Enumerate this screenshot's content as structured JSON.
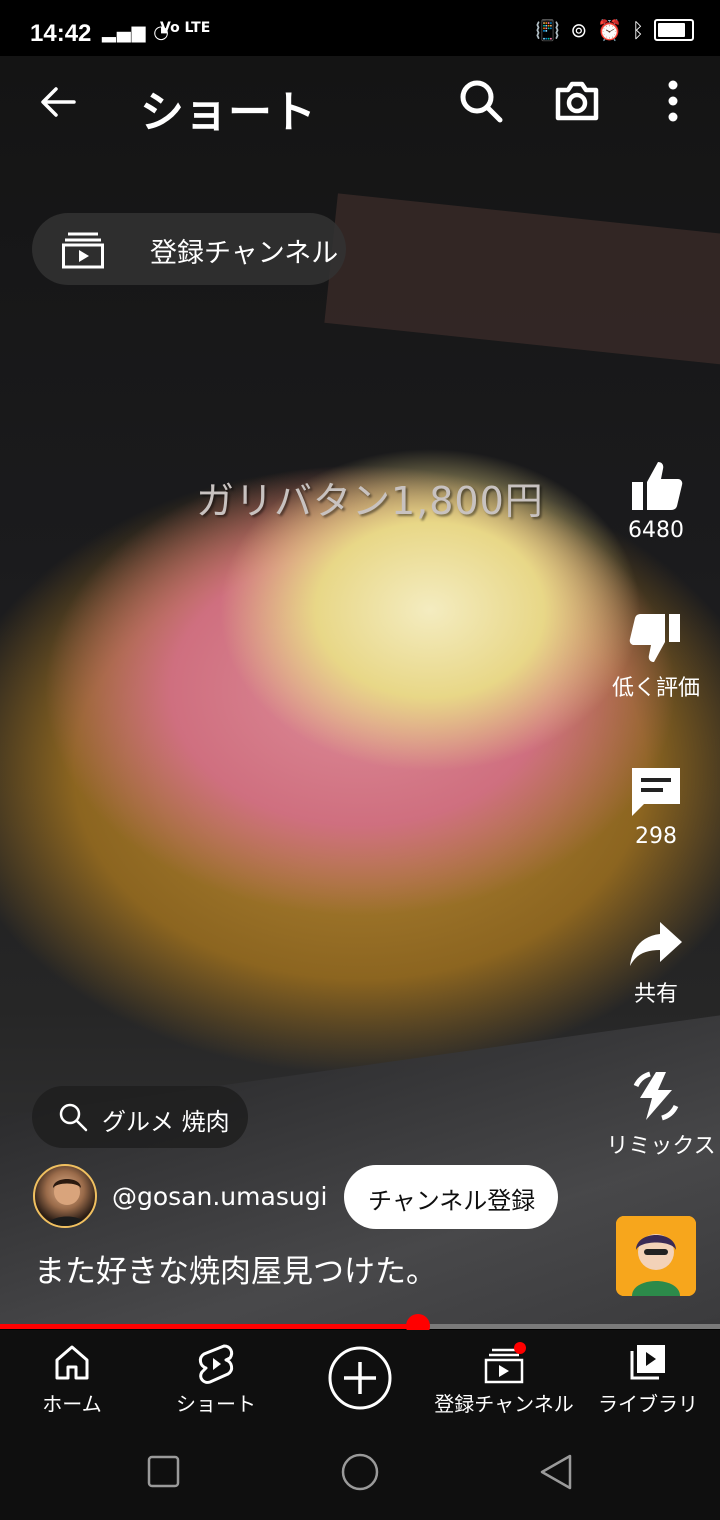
{
  "status_bar": {
    "time": "14:42",
    "network": "Vo LTE"
  },
  "top_bar": {
    "title": "ショート"
  },
  "subscriptions_chip": {
    "label": "登録チャンネル"
  },
  "video_overlay_text": "ガリバタン1,800円",
  "actions": {
    "like_count": "6480",
    "dislike_label": "低く評価",
    "comment_count": "298",
    "share_label": "共有",
    "remix_label": "リミックス"
  },
  "search_tag": {
    "label": "グルメ 焼肉"
  },
  "channel": {
    "handle": "@gosan.umasugi",
    "subscribe_label": "チャンネル登録"
  },
  "caption": "また好きな焼肉屋見つけた。",
  "progress": {
    "fraction": 0.58
  },
  "bottom_nav": [
    {
      "label": "ホーム",
      "icon": "home-icon"
    },
    {
      "label": "ショート",
      "icon": "shorts-icon"
    },
    {
      "label": "",
      "icon": "create-plus-icon"
    },
    {
      "label": "登録チャンネル",
      "icon": "subscriptions-icon",
      "badge": true
    },
    {
      "label": "ライブラリ",
      "icon": "library-icon"
    }
  ],
  "colors": {
    "accent": "#ff0000",
    "background": "#000000",
    "nav_background": "#0f0f0f"
  }
}
